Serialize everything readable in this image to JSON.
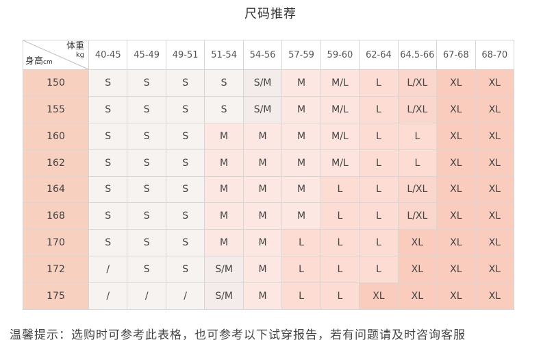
{
  "title": "尺码推荐",
  "corner": {
    "weight_label": "体重",
    "weight_unit": "kg",
    "height_label": "身高",
    "height_unit": "cm"
  },
  "weights": [
    "40-45",
    "45-49",
    "49-51",
    "51-54",
    "54-56",
    "57-59",
    "59-60",
    "62-64",
    "64.5-66",
    "67-68",
    "68-70"
  ],
  "rows": [
    {
      "height": "150",
      "sizes": [
        "S",
        "S",
        "S",
        "S",
        "S/M",
        "M",
        "M/L",
        "L",
        "L/XL",
        "XL",
        "XL"
      ]
    },
    {
      "height": "155",
      "sizes": [
        "S",
        "S",
        "S",
        "S",
        "S/M",
        "M",
        "M/L",
        "L",
        "L/XL",
        "XL",
        "XL"
      ]
    },
    {
      "height": "160",
      "sizes": [
        "S",
        "S",
        "S",
        "M",
        "M",
        "M",
        "M/L",
        "L",
        "L",
        "XL",
        "XL"
      ]
    },
    {
      "height": "162",
      "sizes": [
        "S",
        "S",
        "S",
        "M",
        "M",
        "M",
        "M/L",
        "L",
        "L",
        "XL",
        "XL"
      ]
    },
    {
      "height": "164",
      "sizes": [
        "S",
        "S",
        "S",
        "M",
        "M",
        "M",
        "L",
        "L",
        "L/XL",
        "XL",
        "XL"
      ]
    },
    {
      "height": "168",
      "sizes": [
        "S",
        "S",
        "S",
        "M",
        "M",
        "M",
        "L",
        "L",
        "L/XL",
        "XL",
        "XL"
      ]
    },
    {
      "height": "170",
      "sizes": [
        "S",
        "S",
        "S",
        "M",
        "M",
        "L",
        "L",
        "L",
        "XL",
        "XL",
        "XL"
      ]
    },
    {
      "height": "172",
      "sizes": [
        "/",
        "S",
        "S",
        "S/M",
        "M",
        "L",
        "L",
        "L",
        "XL",
        "XL",
        "XL"
      ]
    },
    {
      "height": "175",
      "sizes": [
        "/",
        "/",
        "/",
        "S/M",
        "M",
        "L",
        "L",
        "XL",
        "XL",
        "XL",
        "XL"
      ]
    }
  ],
  "note": "温馨提示：选购时可参考此表格，也可参考以下试穿报告，若有问题请及时咨询客服",
  "colors": {
    "height_column": "#f8d0c0",
    "xl": "#f9ccbd",
    "l": "#fcdcd3",
    "m": "#fde7e2",
    "s": "#f7f3f1"
  }
}
